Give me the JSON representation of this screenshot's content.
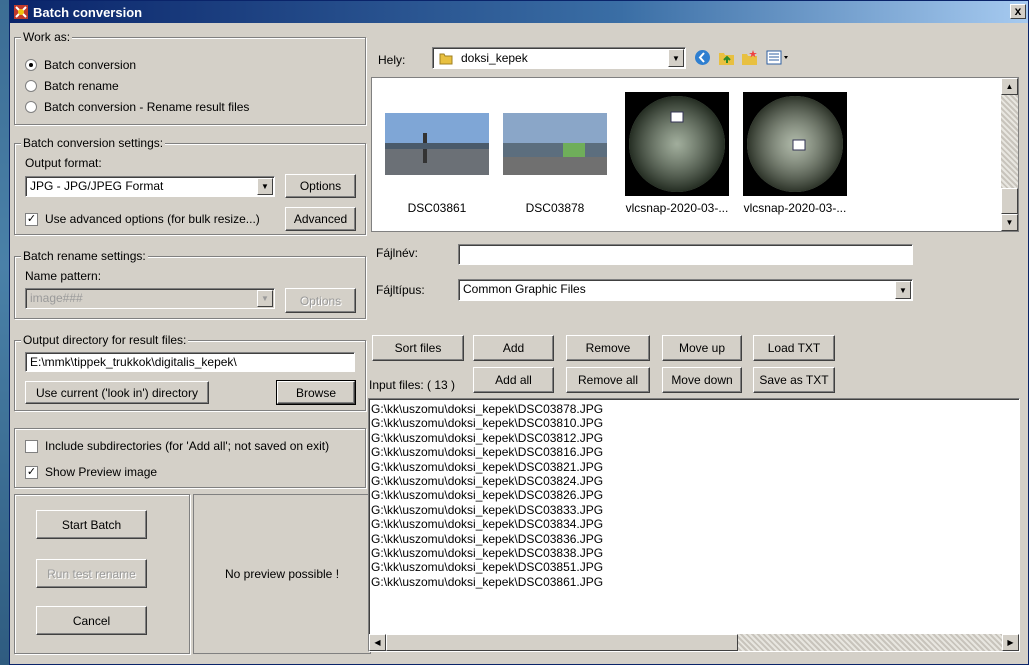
{
  "window": {
    "title": "Batch conversion",
    "close_label": "x"
  },
  "work_as": {
    "title": "Work as:",
    "options": [
      "Batch conversion",
      "Batch rename",
      "Batch conversion - Rename result files"
    ],
    "selected": 0
  },
  "conversion_settings": {
    "title": "Batch conversion settings:",
    "output_format_label": "Output format:",
    "output_format_value": "JPG - JPG/JPEG Format",
    "options_button": "Options",
    "advanced_check_label": "Use advanced options (for bulk resize...)",
    "advanced_checked": true,
    "advanced_button": "Advanced"
  },
  "rename_settings": {
    "title": "Batch rename settings:",
    "name_pattern_label": "Name pattern:",
    "name_pattern_value": "image###",
    "options_button": "Options"
  },
  "output_dir": {
    "title": "Output directory for result files:",
    "path": "E:\\mmk\\tippek_trukkok\\digitalis_kepek\\",
    "use_current_button": "Use current ('look in') directory",
    "browse_button": "Browse"
  },
  "options": {
    "include_subdirs_label": "Include subdirectories (for 'Add all'; not saved on exit)",
    "include_subdirs_checked": false,
    "show_preview_label": "Show Preview image",
    "show_preview_checked": true
  },
  "actions": {
    "start_batch": "Start Batch",
    "run_test_rename": "Run test rename",
    "cancel": "Cancel"
  },
  "preview": {
    "text": "No preview possible !"
  },
  "browser": {
    "location_label": "Hely:",
    "location_value": "doksi_kepek",
    "thumbnails": [
      {
        "caption": "DSC03861"
      },
      {
        "caption": "DSC03878"
      },
      {
        "caption": "vlcsnap-2020-03-..."
      },
      {
        "caption": "vlcsnap-2020-03-..."
      }
    ],
    "filename_label": "Fájlnév:",
    "filename_value": "",
    "filetype_label": "Fájltípus:",
    "filetype_value": "Common Graphic Files"
  },
  "list_buttons": {
    "sort_files": "Sort files",
    "add": "Add",
    "remove": "Remove",
    "move_up": "Move up",
    "load_txt": "Load TXT",
    "add_all": "Add all",
    "remove_all": "Remove all",
    "move_down": "Move down",
    "save_as_txt": "Save as TXT"
  },
  "input_files": {
    "label": "Input files: ( 13 )",
    "files": [
      "G:\\kk\\uszomu\\doksi_kepek\\DSC03878.JPG",
      "G:\\kk\\uszomu\\doksi_kepek\\DSC03810.JPG",
      "G:\\kk\\uszomu\\doksi_kepek\\DSC03812.JPG",
      "G:\\kk\\uszomu\\doksi_kepek\\DSC03816.JPG",
      "G:\\kk\\uszomu\\doksi_kepek\\DSC03821.JPG",
      "G:\\kk\\uszomu\\doksi_kepek\\DSC03824.JPG",
      "G:\\kk\\uszomu\\doksi_kepek\\DSC03826.JPG",
      "G:\\kk\\uszomu\\doksi_kepek\\DSC03833.JPG",
      "G:\\kk\\uszomu\\doksi_kepek\\DSC03834.JPG",
      "G:\\kk\\uszomu\\doksi_kepek\\DSC03836.JPG",
      "G:\\kk\\uszomu\\doksi_kepek\\DSC03838.JPG",
      "G:\\kk\\uszomu\\doksi_kepek\\DSC03851.JPG",
      "G:\\kk\\uszomu\\doksi_kepek\\DSC03861.JPG"
    ]
  },
  "colors": {
    "title_bar": "#0a246a",
    "face": "#d4d0c8"
  }
}
